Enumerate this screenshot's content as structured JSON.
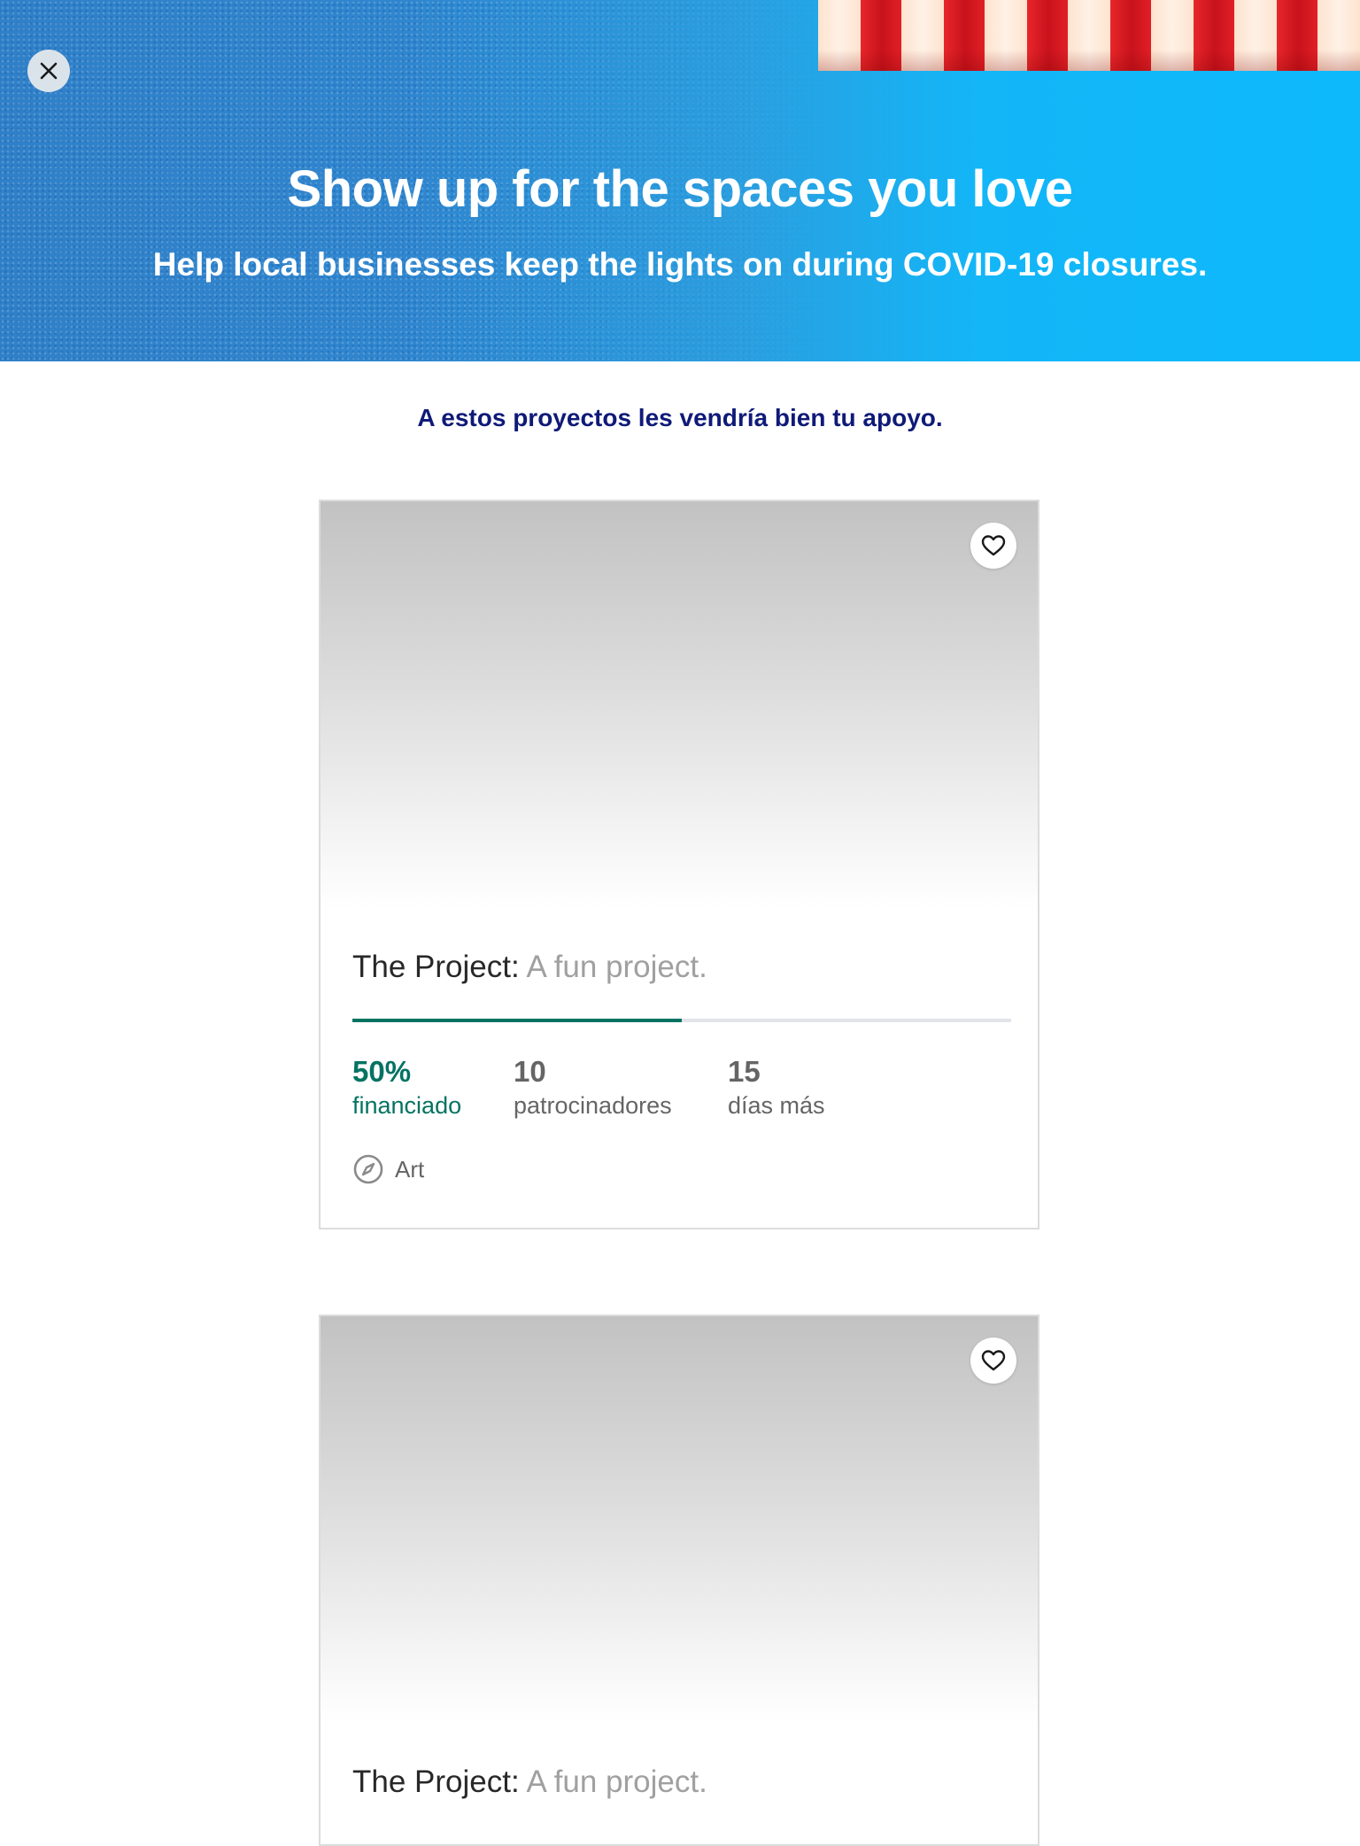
{
  "hero": {
    "title": "Show up for the spaces you love",
    "subtitle": "Help local businesses keep the lights on during COVID-19 closures."
  },
  "section": {
    "heading": "A estos proyectos les vendría bien tu apoyo."
  },
  "colors": {
    "accent_green": "#037362",
    "heading_navy": "#0f1a78"
  },
  "icons": {
    "close": "close-icon",
    "save": "heart-icon",
    "category": "compass-icon"
  },
  "projects": [
    {
      "name": "The Project:",
      "blurb": "A fun project.",
      "funded_percent": 50,
      "funded_value": "50%",
      "funded_label": "financiado",
      "backers_value": "10",
      "backers_label": "patrocinadores",
      "days_value": "15",
      "days_label": "días más",
      "category": "Art"
    },
    {
      "name": "The Project:",
      "blurb": "A fun project."
    }
  ]
}
